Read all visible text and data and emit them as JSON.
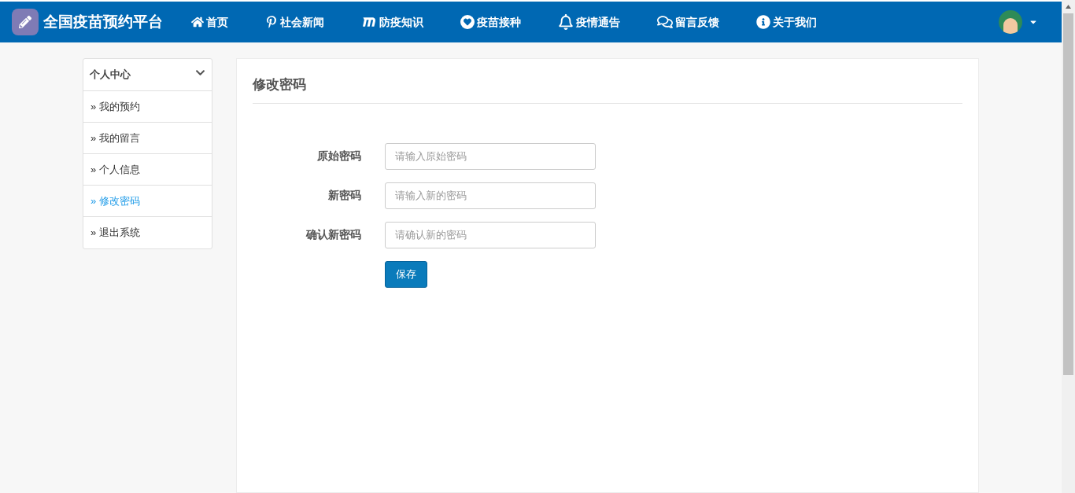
{
  "header": {
    "brand": "全国疫苗预约平台",
    "nav": [
      {
        "label": "首页"
      },
      {
        "label": "社会新闻"
      },
      {
        "label": "防疫知识"
      },
      {
        "label": "疫苗接种"
      },
      {
        "label": "疫情通告"
      },
      {
        "label": "留言反馈"
      },
      {
        "label": "关于我们"
      }
    ]
  },
  "sidebar": {
    "title": "个人中心",
    "expanded": true,
    "items": [
      {
        "marker": "»",
        "label": "我的预约",
        "selected": false
      },
      {
        "marker": "»",
        "label": "我的留言",
        "selected": false
      },
      {
        "marker": "»",
        "label": "个人信息",
        "selected": false
      },
      {
        "marker": "»",
        "label": "修改密码",
        "selected": true
      },
      {
        "marker": "»",
        "label": "退出系统",
        "selected": false
      }
    ]
  },
  "form": {
    "title": "修改密码",
    "fields": [
      {
        "label": "原始密码",
        "placeholder": "请输入原始密码"
      },
      {
        "label": "新密码",
        "placeholder": "请输入新的密码"
      },
      {
        "label": "确认新密码",
        "placeholder": "请确认新的密码"
      }
    ],
    "submit": "保存"
  }
}
